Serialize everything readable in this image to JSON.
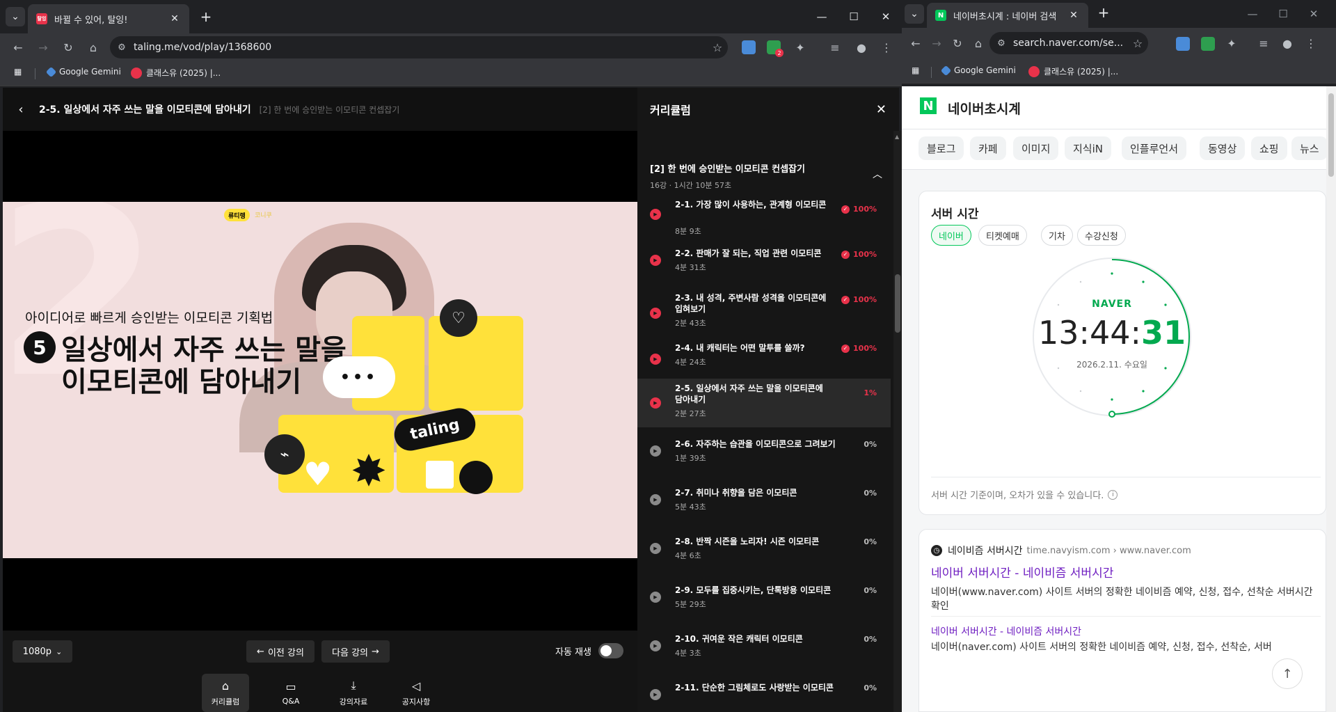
{
  "left_window": {
    "tab": {
      "title": "바뀔 수 있어, 탈잉!",
      "favicon_color": "#e8324a"
    },
    "address": "taling.me/vod/play/1368600",
    "bookmarks": [
      "Google Gemini",
      "클래스유 (2025) |..."
    ],
    "ext_badge": "2"
  },
  "right_window": {
    "tab": {
      "title": "네이버초시계 : 네이버 검색",
      "favicon_color": "#03c75a"
    },
    "address": "search.naver.com/se...",
    "bookmarks": [
      "Google Gemini",
      "클래스유 (2025) |..."
    ]
  },
  "player": {
    "title": "2-5. 일상에서 자주 쓰는 말을 이모티콘에 담아내기",
    "section": "[2] 한 번에 승인받는 이모티콘 컨셉잡기",
    "video": {
      "badge_name": "류티렝",
      "badge_name2": "코니쿠",
      "subtitle": "아이디어로 빠르게 승인받는 이모티콘 기획법",
      "number": "5",
      "line1": "일상에서 자주 쓰는 말을",
      "line2": "이모티콘에 담아내기",
      "logo": "taling",
      "dots": "•••"
    },
    "quality": "1080p",
    "prev": "이전 강의",
    "next": "다음 강의",
    "autoplay": "자동 재생",
    "bottom_nav": [
      "커리큘럼",
      "Q&A",
      "강의자료",
      "공지사항"
    ]
  },
  "curriculum": {
    "heading": "커리큘럼",
    "section_title": "[2] 한 번에 승인받는 이모티콘 컨셉잡기",
    "section_meta": "16강 · 1시간 10분 57초",
    "items": [
      {
        "title": "2-1. 가장 많이 사용하는, 관계형 이모티콘",
        "dur": "8분 9초",
        "progress": "100%",
        "done": true
      },
      {
        "title": "2-2. 판매가 잘 되는, 직업 관련 이모티콘",
        "dur": "4분 31초",
        "progress": "100%",
        "done": true
      },
      {
        "title": "2-3. 내 성격, 주변사람 성격을 이모티콘에 입혀보기",
        "dur": "2분 43초",
        "progress": "100%",
        "done": true
      },
      {
        "title": "2-4. 내 캐릭터는 어떤 말투를 쓸까?",
        "dur": "4분 24초",
        "progress": "100%",
        "done": true
      },
      {
        "title": "2-5. 일상에서 자주 쓰는 말을 이모티콘에 담아내기",
        "dur": "2분 27초",
        "progress": "1%",
        "current": true
      },
      {
        "title": "2-6. 자주하는 습관을 이모티콘으로 그려보기",
        "dur": "1분 39초",
        "progress": "0%"
      },
      {
        "title": "2-7. 취미나 취향을 담은 이모티콘",
        "dur": "5분 43초",
        "progress": "0%"
      },
      {
        "title": "2-8. 반짝 시즌을 노리자! 시즌 이모티콘",
        "dur": "4분 6초",
        "progress": "0%"
      },
      {
        "title": "2-9. 모두를 집중시키는, 단톡방용 이모티콘",
        "dur": "5분 29초",
        "progress": "0%"
      },
      {
        "title": "2-10. 귀여운 작은 캐릭터 이모티콘",
        "dur": "4분 3초",
        "progress": "0%"
      },
      {
        "title": "2-11. 단순한 그림체로도 사랑받는 이모티콘",
        "dur": "",
        "progress": "0%"
      }
    ]
  },
  "naver": {
    "brand": "네이버초시계",
    "tabs": [
      "블로그",
      "카페",
      "이미지",
      "지식iN",
      "인플루언서",
      "동영상",
      "쇼핑",
      "뉴스"
    ],
    "card_title": "서버 시간",
    "sub_tabs": [
      "네이버",
      "티켓예매",
      "기차",
      "수강신청"
    ],
    "clock_brand": "NAVER",
    "time_hm": "13:44:",
    "time_s": "31",
    "date": "2026.2.11. 수요일",
    "note": "서버 시간 기준이며, 오차가 있을 수 있습니다.",
    "result": {
      "site": "네이비즘 서버시간",
      "url": "time.navyism.com › www.naver.com",
      "title": "네이버 서버시간 - 네이비즘 서버시간",
      "desc": "네이버(www.naver.com) 사이트 서버의 정확한 네이비즘 예약, 신청, 접수, 선착순 서버시간 확인",
      "sub_title": "네이버 서버시간 - 네이비즘 서버시간",
      "sub_desc": "네이버(naver.com) 사이트 서버의 정확한 네이비즘 예약, 신청, 접수, 선착순, 서버"
    }
  }
}
